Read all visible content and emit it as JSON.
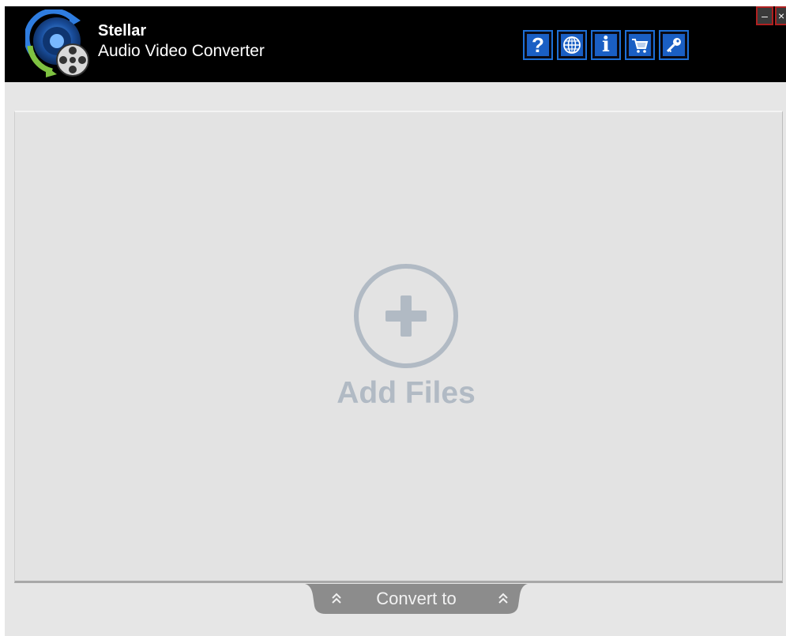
{
  "app": {
    "name": "Stellar",
    "subtitle": "Audio Video Converter"
  },
  "toolbar": {
    "buttons": [
      {
        "name": "help",
        "glyph": "?",
        "icon": "help-icon"
      },
      {
        "name": "language",
        "glyph": "",
        "icon": "globe-icon"
      },
      {
        "name": "about",
        "glyph": "i",
        "icon": "info-icon"
      },
      {
        "name": "buy",
        "glyph": "",
        "icon": "cart-icon"
      },
      {
        "name": "activate",
        "glyph": "",
        "icon": "key-icon"
      }
    ]
  },
  "window_controls": {
    "minimize": "–",
    "close": "×"
  },
  "main": {
    "add_files_label": "Add Files"
  },
  "footer": {
    "convert_label": "Convert to"
  },
  "colors": {
    "titlebar": "#000000",
    "accent": "#1a5fc4",
    "background": "#e6e6e6",
    "add_files": "#b1bac4",
    "convert_tab": "#8c8c8c"
  }
}
